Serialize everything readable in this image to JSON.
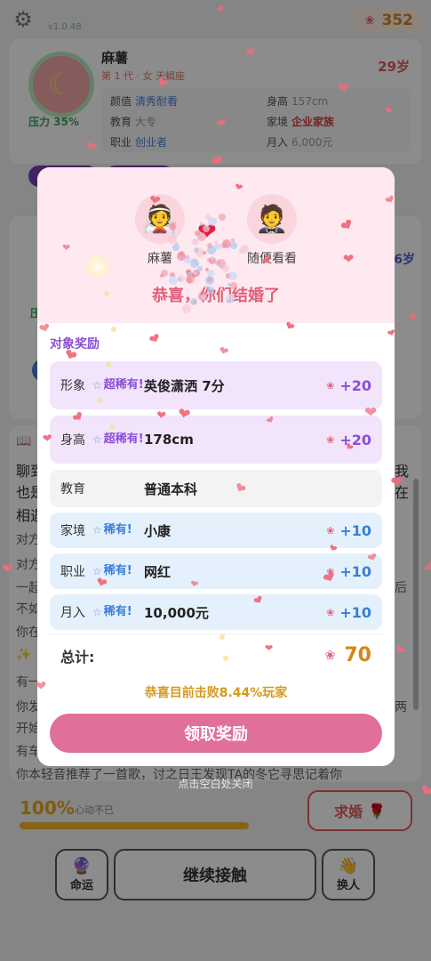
{
  "app": {
    "version": "v1.0.48",
    "coins": "352",
    "icons": {
      "settings": "gear-icon",
      "lotus": "lotus-icon"
    }
  },
  "profile": {
    "name": "麻薯",
    "generation": "第 1 代 · 女 天蝎座",
    "age": "29岁",
    "pressure": "压力 35%",
    "stats": {
      "looks_label": "颜值",
      "looks_value": "清秀耐看",
      "height_label": "身高",
      "height_value": "157cm",
      "edu_label": "教育",
      "edu_value": "大专",
      "family_label": "家境",
      "family_value": "企业家族",
      "job_label": "职业",
      "job_value": "创业者",
      "income_label": "月入",
      "income_value": "6,000元"
    }
  },
  "card2": {
    "age": "6岁",
    "status": "压"
  },
  "story": {
    "lines": [
      {
        "text": "聊到",
        "tail": "我"
      },
      {
        "text": "也是",
        "tail": "在"
      },
      {
        "text": "相遇"
      },
      {
        "text": "对方"
      },
      {
        "text": "对方"
      },
      {
        "text": "一起",
        "tail": "后"
      },
      {
        "text": "不如"
      },
      {
        "text": "你在"
      },
      {
        "text": "✨"
      },
      {
        "text": "有一"
      },
      {
        "text": "你发",
        "tail": "两"
      },
      {
        "text": "开始"
      },
      {
        "text": "有车"
      },
      {
        "text": "你本轻音推荐了一首歌，讨之日王发现TA的冬它寻思记着你"
      }
    ]
  },
  "bottom": {
    "affinity": "100%",
    "affinity_label": "心动不已",
    "affinity_progress": 1.0,
    "propose": "求婚",
    "fate": "命运",
    "continue": "继续接触",
    "swap": "换人"
  },
  "modal": {
    "player_name": "麻薯",
    "partner_name": "随便看看",
    "congrats": "恭喜，你们结婚了",
    "section_title": "对象奖励",
    "rewards": [
      {
        "category": "形象",
        "rarity": "超稀有!",
        "value": "英俊潇洒 7分",
        "bonus": "+20",
        "tier": "epic"
      },
      {
        "category": "身高",
        "rarity": "超稀有!",
        "value": "178cm",
        "bonus": "+20",
        "tier": "epic"
      },
      {
        "category": "教育",
        "rarity": "",
        "value": "普通本科",
        "bonus": "",
        "tier": "norm"
      },
      {
        "category": "家境",
        "rarity": "稀有!",
        "value": "小康",
        "bonus": "+10",
        "tier": "rare"
      },
      {
        "category": "职业",
        "rarity": "稀有!",
        "value": "网红",
        "bonus": "+10",
        "tier": "rare"
      },
      {
        "category": "月入",
        "rarity": "稀有!",
        "value": "10,000元",
        "bonus": "+10",
        "tier": "rare"
      }
    ],
    "total_label": "总计:",
    "total_value": "70",
    "beat_text": "恭喜目前击败8.44%玩家",
    "claim": "领取奖励",
    "close_hint": "点击空白处关闭"
  },
  "colors": {
    "accent_pink": "#e0709a",
    "gold": "#d4861c",
    "epic_purple": "#8a4fd6",
    "rare_blue": "#3a7fd6",
    "heart_red": "#e02040"
  }
}
